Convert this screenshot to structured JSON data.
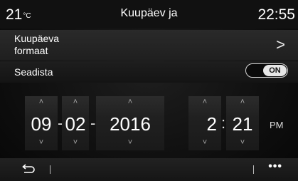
{
  "header": {
    "temperature": "21",
    "temperature_unit": "°C",
    "title": "Kuupäev ja",
    "clock": "22:55"
  },
  "settings": {
    "date_format_label": "Kuupäeva formaat",
    "set_label": "Seadista",
    "set_toggle_state": "ON"
  },
  "picker": {
    "day": "09",
    "month": "02",
    "year": "2016",
    "hour": "2",
    "minute": "21",
    "ampm": "PM",
    "date_separator": "-",
    "time_separator": ":"
  },
  "icons": {
    "back": "back-arrow-icon",
    "more": "more-icon",
    "chevron_right": "chevron-right-icon",
    "chevron_up": "chevron-up-icon",
    "chevron_down": "chevron-down-icon"
  }
}
